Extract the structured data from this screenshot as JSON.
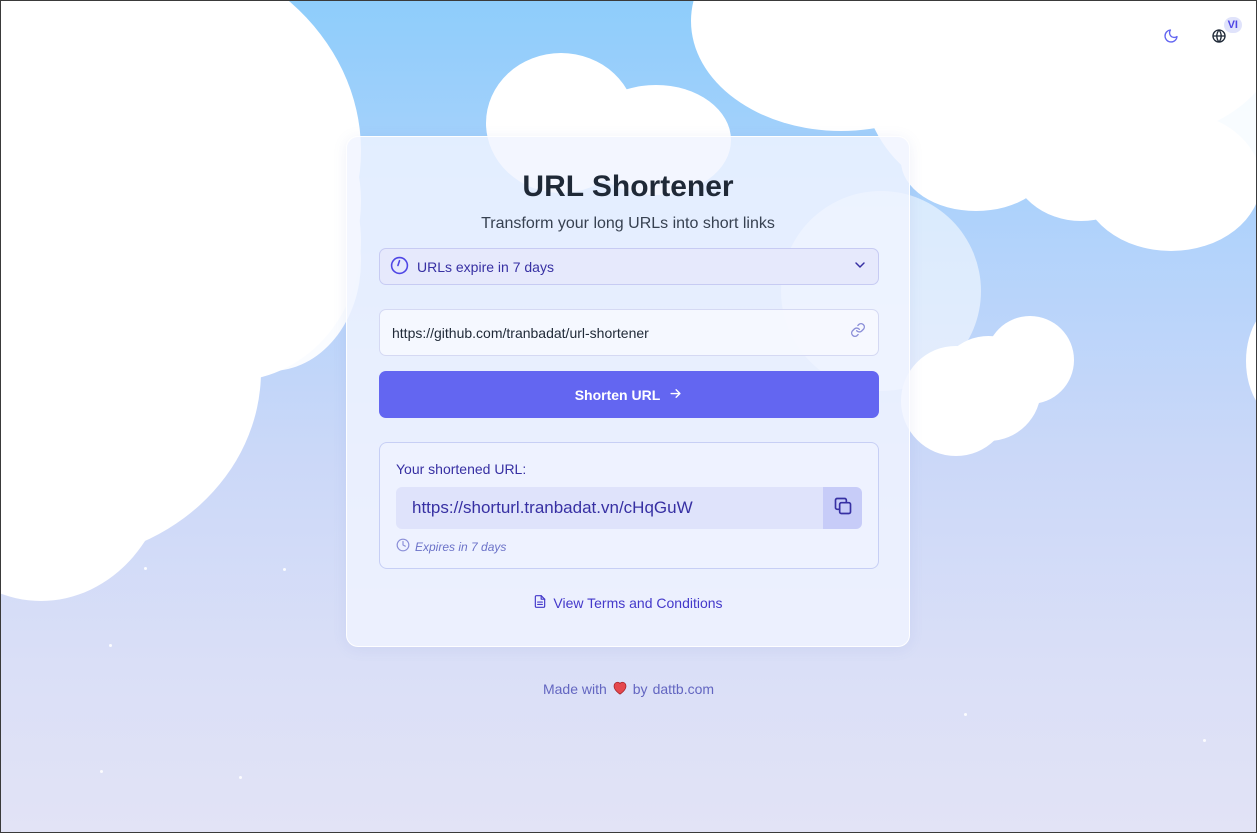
{
  "top_controls": {
    "theme_toggle_icon": "moon-icon",
    "language_icon": "globe-icon",
    "language_badge": "VI"
  },
  "card": {
    "title": "URL Shortener",
    "subtitle": "Transform your long URLs into short links",
    "expiry_select": {
      "icon": "clock-icon",
      "selected": "URLs expire in 7 days"
    },
    "url_input": {
      "value": "https://github.com/tranbadat/url-shortener",
      "icon": "link-icon"
    },
    "shorten_button": {
      "label": "Shorten URL",
      "icon": "arrow-right-icon"
    },
    "result": {
      "label": "Your shortened URL:",
      "short_url": "https://shorturl.tranbadat.vn/cHqGuW",
      "copy_icon": "copy-icon",
      "expires_note": "Expires in 7 days"
    },
    "terms_link": {
      "label": "View Terms and Conditions",
      "icon": "document-icon"
    }
  },
  "footer": {
    "made_with": "Made with",
    "heart_icon": "heart-icon",
    "by": "by",
    "site": "dattb.com"
  },
  "colors": {
    "accent": "#6366f1",
    "accent_text": "#3730a3",
    "heart": "#e5484d"
  }
}
